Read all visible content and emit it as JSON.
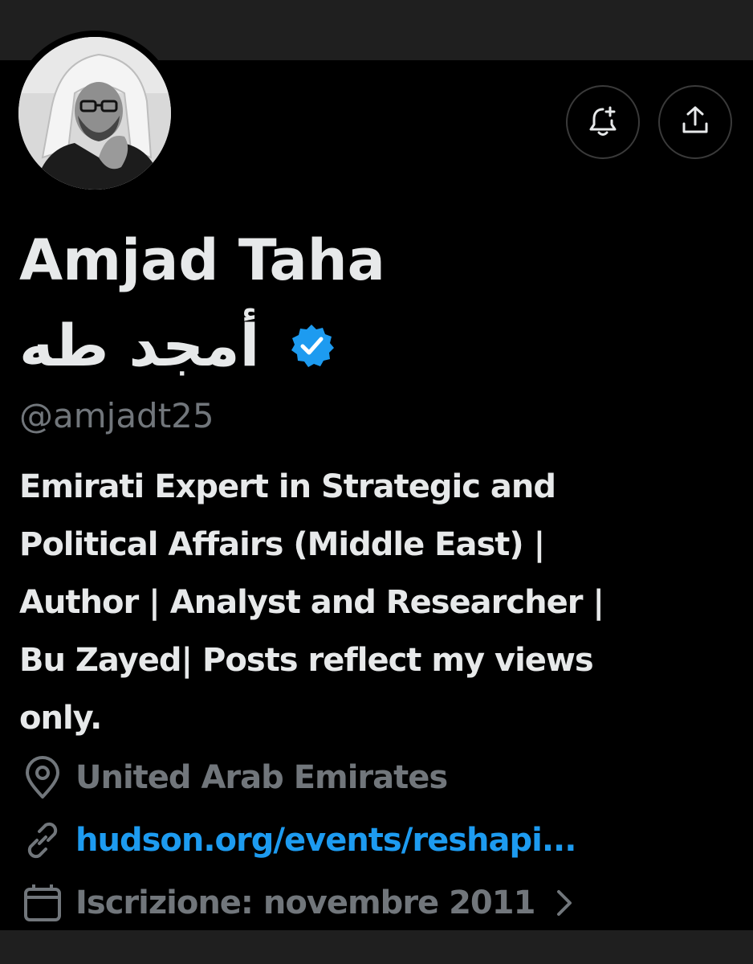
{
  "profile": {
    "display_name": "Amjad Taha",
    "arabic_name": "أمجد طه",
    "handle": "@amjadt25",
    "bio_lines": [
      "Emirati Expert in Strategic and",
      "Political Affairs (Middle East) |",
      "Author | Analyst and Researcher |",
      "Bu Zayed| Posts reflect my views",
      "only."
    ],
    "location": "United Arab Emirates",
    "website": "hudson.org/events/reshapi...",
    "joined": "Iscrizione: novembre 2011",
    "verified": true
  },
  "icons": {
    "notify": "bell-plus-icon",
    "share": "share-upload-icon",
    "verified": "verified-badge-icon",
    "location": "location-pin-icon",
    "link": "link-icon",
    "calendar": "calendar-icon",
    "chevron": "chevron-right-icon"
  },
  "colors": {
    "background": "#000000",
    "text_primary": "#e7e9ea",
    "text_secondary": "#71767b",
    "link": "#1d9bf0",
    "verified_badge": "#1d9bf0",
    "button_border": "#3a3a3a",
    "strip": "#1f1f1f"
  }
}
